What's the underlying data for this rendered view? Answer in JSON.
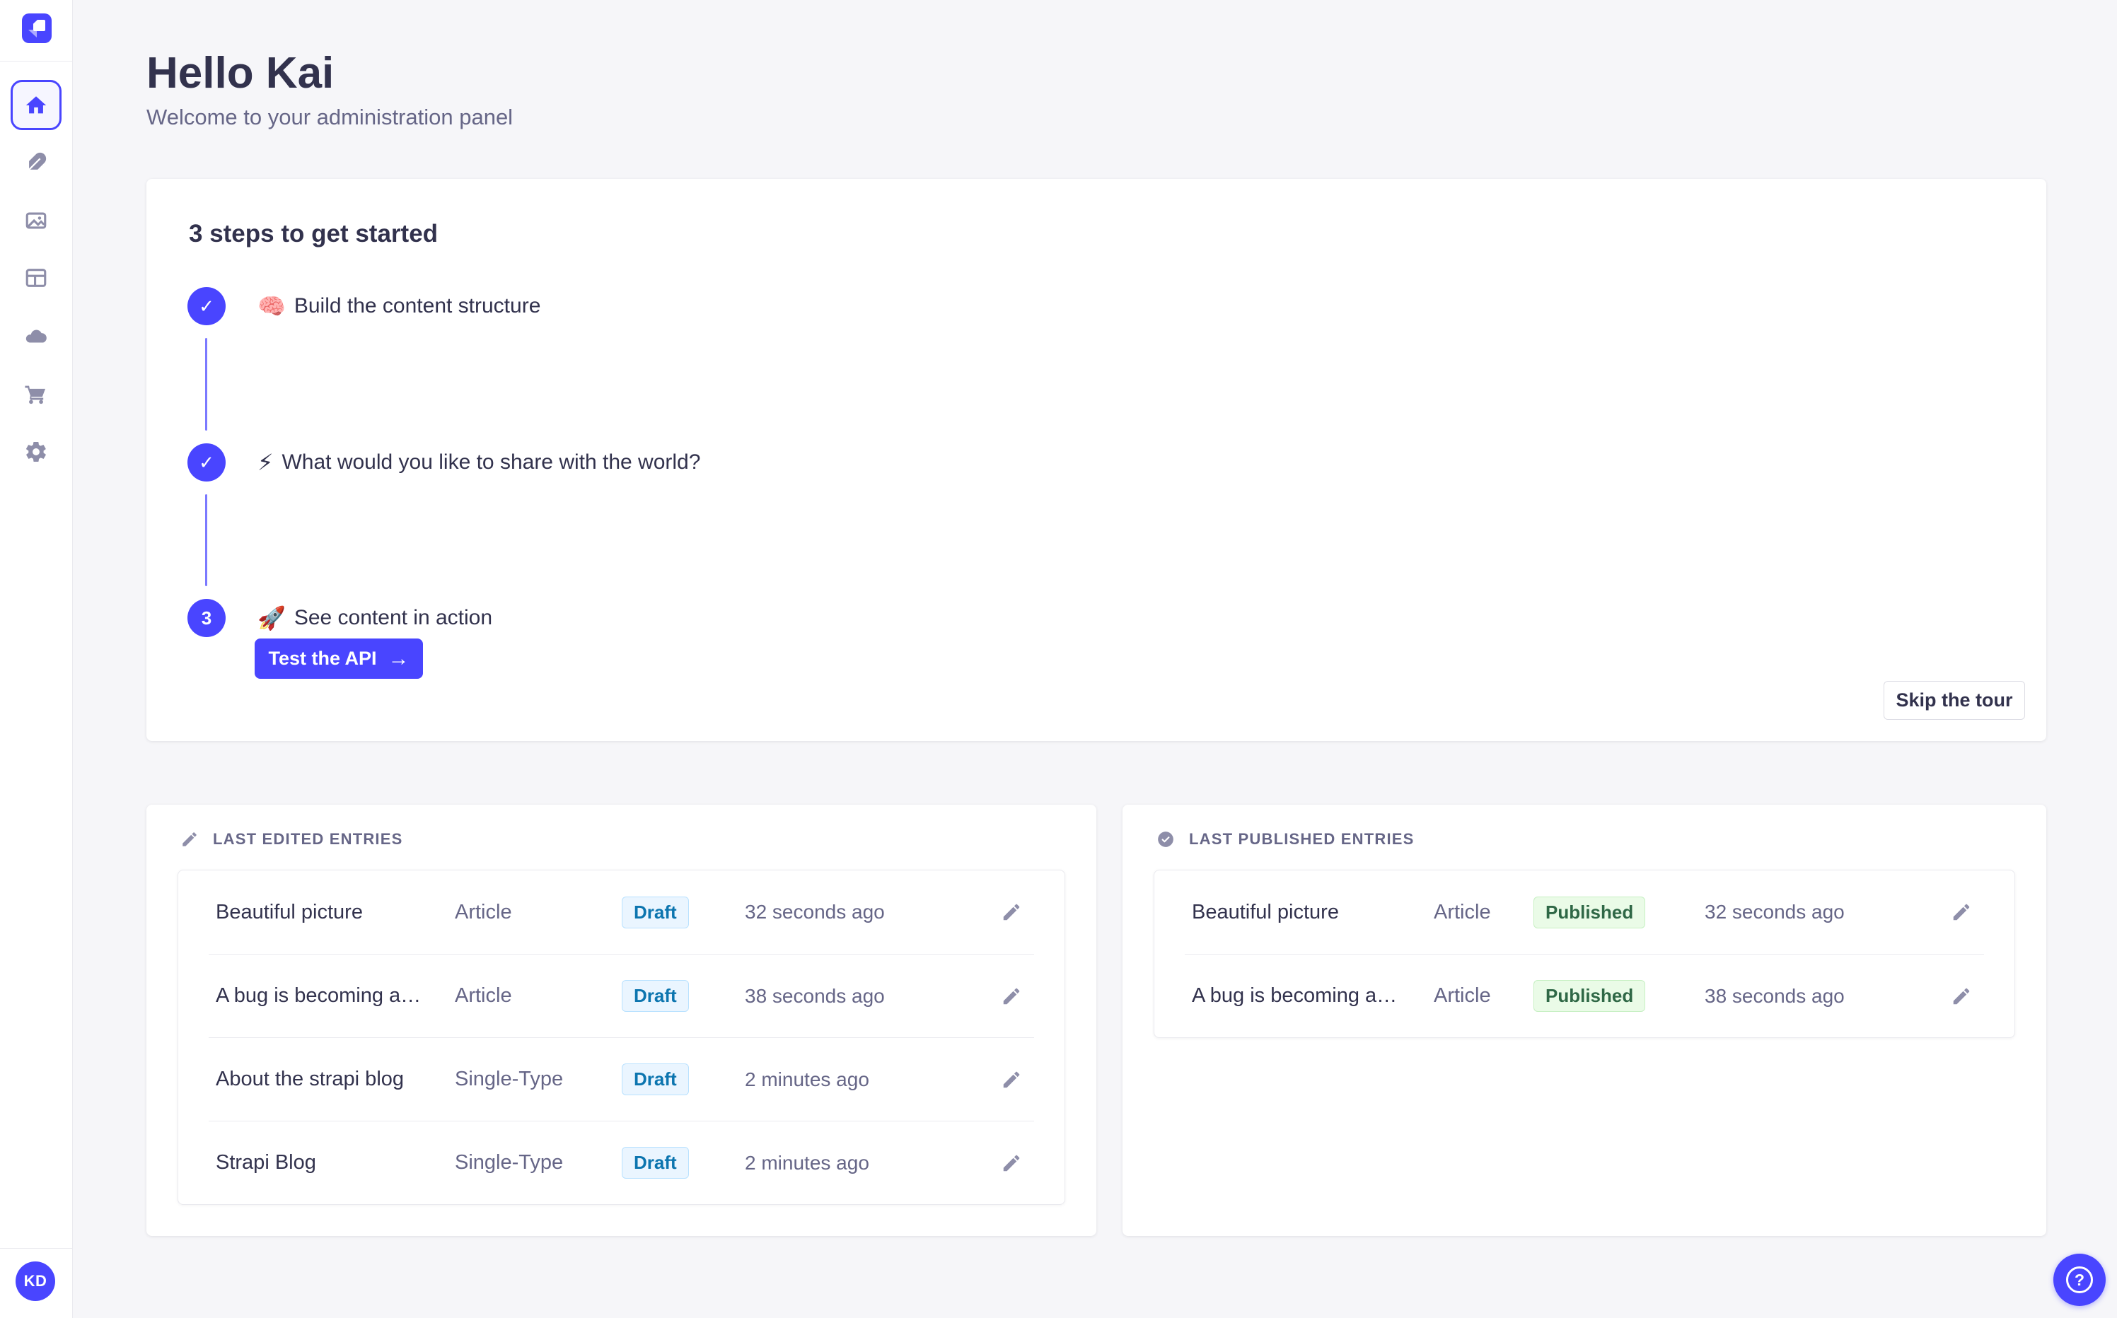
{
  "colors": {
    "primary": "#4945FF",
    "connector": "#7B79FF",
    "background": "#F6F6F9",
    "text_dark": "#32324D",
    "text_gray": "#666687",
    "icon_gray": "#8E8EA9",
    "border": "#EAEAEF",
    "draft_bg": "#EAF5FF",
    "draft_text": "#0C75AF",
    "published_bg": "#EAFBE7",
    "published_text": "#2F6846"
  },
  "sidebar": {
    "items": [
      {
        "name": "home"
      },
      {
        "name": "content-manager"
      },
      {
        "name": "media-library"
      },
      {
        "name": "content-type-builder"
      },
      {
        "name": "deploy"
      },
      {
        "name": "marketplace"
      },
      {
        "name": "settings"
      }
    ],
    "avatar_initials": "KD"
  },
  "header": {
    "title": "Hello Kai",
    "subtitle": "Welcome to your administration panel"
  },
  "tour": {
    "title": "3 steps to get started",
    "steps": [
      {
        "emoji": "🧠",
        "label": "Build the content structure",
        "state": "done"
      },
      {
        "emoji": "⚡",
        "label": "What would you like to share with the world?",
        "state": "done"
      },
      {
        "emoji": "🚀",
        "label": "See content in action",
        "state": "active",
        "number": "3"
      }
    ],
    "check_glyph": "✓",
    "test_api_label": "Test the API",
    "test_api_arrow": "→",
    "skip_label": "Skip the tour"
  },
  "last_edited": {
    "title": "LAST EDITED ENTRIES",
    "rows": [
      {
        "title": "Beautiful picture",
        "type": "Article",
        "status": "Draft",
        "time": "32 seconds ago"
      },
      {
        "title": "A bug is becoming a…",
        "type": "Article",
        "status": "Draft",
        "time": "38 seconds ago"
      },
      {
        "title": "About the strapi blog",
        "type": "Single-Type",
        "status": "Draft",
        "time": "2 minutes ago"
      },
      {
        "title": "Strapi Blog",
        "type": "Single-Type",
        "status": "Draft",
        "time": "2 minutes ago"
      }
    ]
  },
  "last_published": {
    "title": "LAST PUBLISHED ENTRIES",
    "rows": [
      {
        "title": "Beautiful picture",
        "type": "Article",
        "status": "Published",
        "time": "32 seconds ago"
      },
      {
        "title": "A bug is becoming a…",
        "type": "Article",
        "status": "Published",
        "time": "38 seconds ago"
      }
    ]
  },
  "help": {
    "glyph": "?"
  }
}
